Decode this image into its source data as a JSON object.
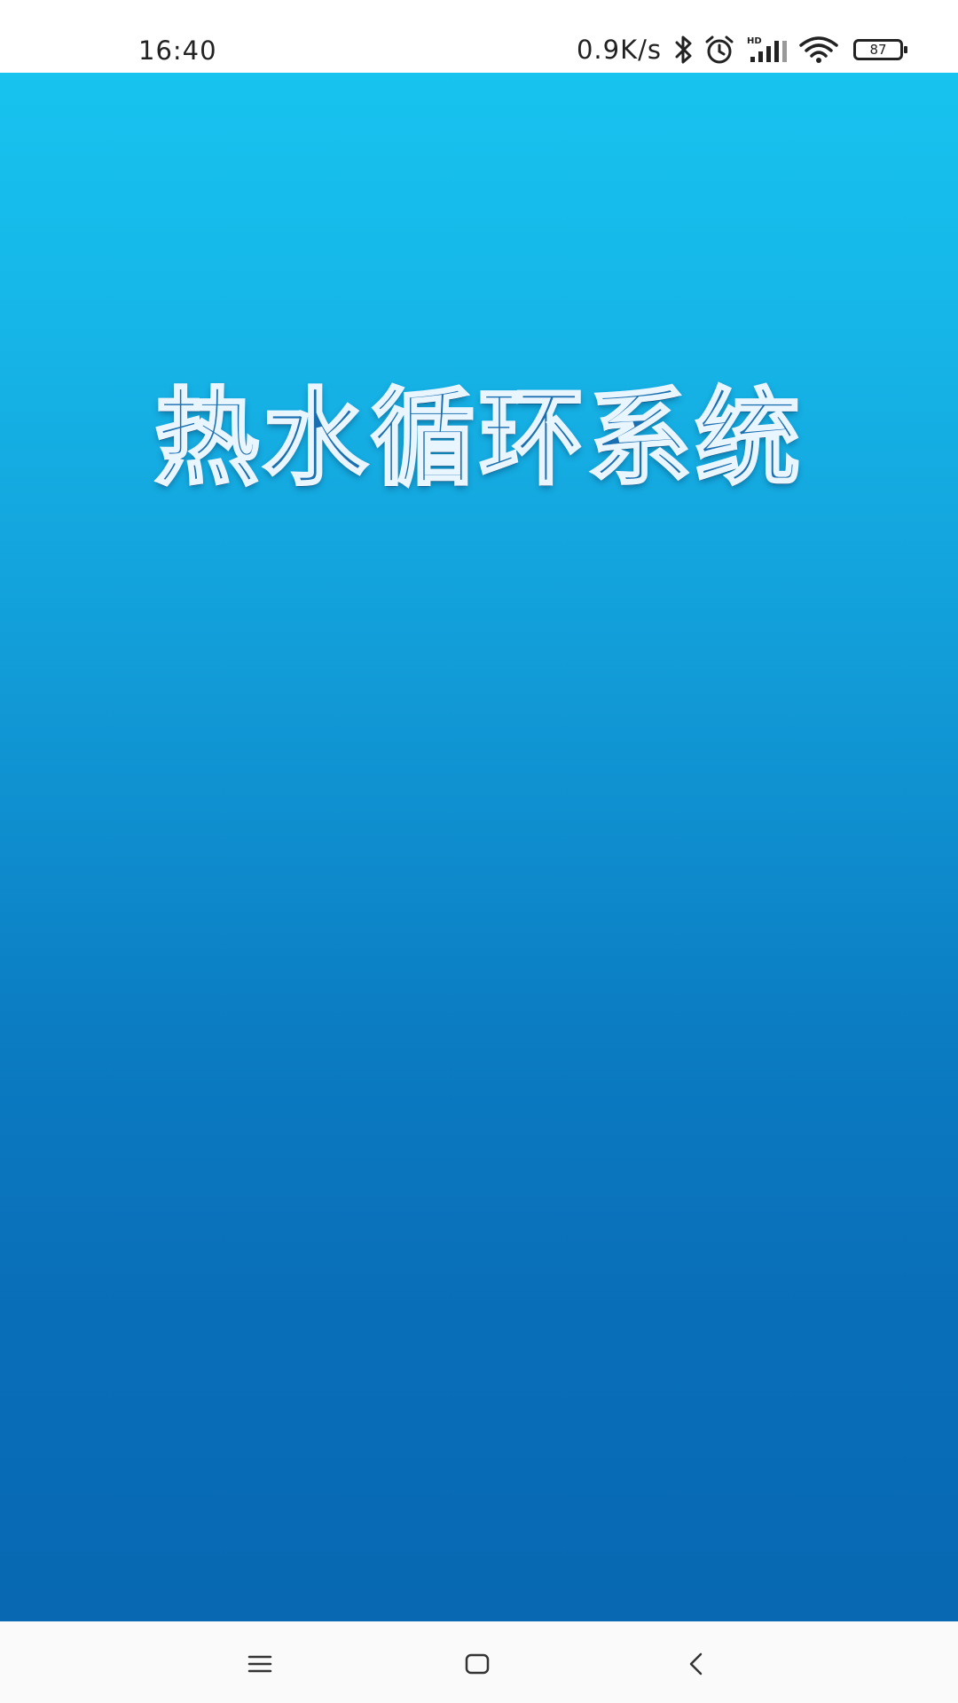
{
  "status_bar": {
    "time": "16:40",
    "net_speed": "0.9K/s",
    "battery_level": "87",
    "icons": [
      "bluetooth-icon",
      "alarm-icon",
      "hd-signal-icon",
      "wifi-icon",
      "battery-icon"
    ]
  },
  "splash": {
    "title": "热水循环系统",
    "colors": {
      "gradient_top": "#17c3ef",
      "gradient_bottom": "#0868b2",
      "title_fill": "#1a6fb0",
      "title_outline": "#eaf6ff"
    }
  },
  "nav_bar": {
    "buttons": [
      "menu-icon",
      "home-icon",
      "back-icon"
    ]
  }
}
